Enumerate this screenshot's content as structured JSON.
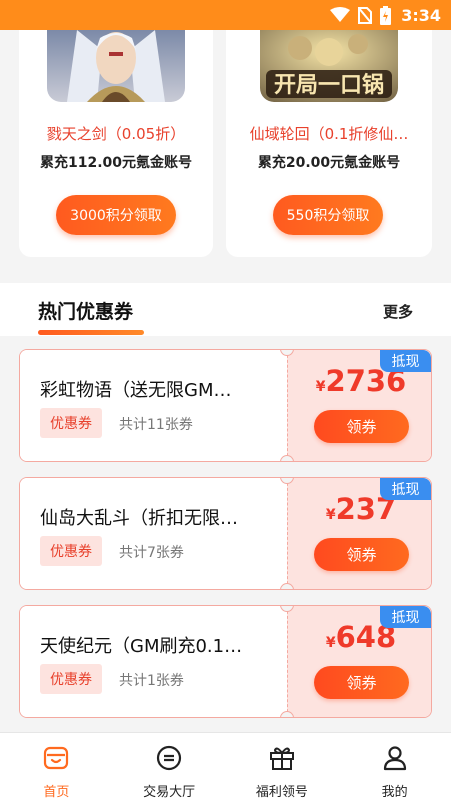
{
  "status_bar": {
    "time": "3:34",
    "icons": [
      "wifi-icon",
      "no-sim-icon",
      "battery-charging-icon"
    ]
  },
  "rewards": [
    {
      "image": "game-cover-warrior",
      "name": "戮天之剑（0.05折）",
      "desc": "累充112.00元氪金账号",
      "button": "3000积分领取"
    },
    {
      "image": "game-cover-kaiju-yikouguo",
      "image_text": "开局一口锅",
      "name": "仙域轮回（0.1折修仙…",
      "desc": "累充20.00元氪金账号",
      "button": "550积分领取"
    }
  ],
  "section": {
    "title": "热门优惠券",
    "more": "更多"
  },
  "coupons": [
    {
      "title": "彩虹物语（送无限GM…",
      "tag": "优惠券",
      "count": "共计11张券",
      "badge": "抵现",
      "currency": "¥",
      "amount": "2736",
      "button": "领券"
    },
    {
      "title": "仙岛大乱斗（折扣无限…",
      "tag": "优惠券",
      "count": "共计7张券",
      "badge": "抵现",
      "currency": "¥",
      "amount": "237",
      "button": "领券"
    },
    {
      "title": "天使纪元（GM刷充0.1…",
      "tag": "优惠券",
      "count": "共计1张券",
      "badge": "抵现",
      "currency": "¥",
      "amount": "648",
      "button": "领券"
    }
  ],
  "bottom_nav": [
    {
      "label": "首页",
      "icon": "home-icon",
      "active": true
    },
    {
      "label": "交易大厅",
      "icon": "trade-icon",
      "active": false
    },
    {
      "label": "福利领号",
      "icon": "gift-icon",
      "active": false
    },
    {
      "label": "我的",
      "icon": "user-icon",
      "active": false
    }
  ],
  "colors": {
    "status_bar": "#ff8c1a",
    "accent": "#ff5a1f",
    "price": "#ef3a2a",
    "badge": "#3a8ef0",
    "nav_active": "#ff6a1f"
  }
}
